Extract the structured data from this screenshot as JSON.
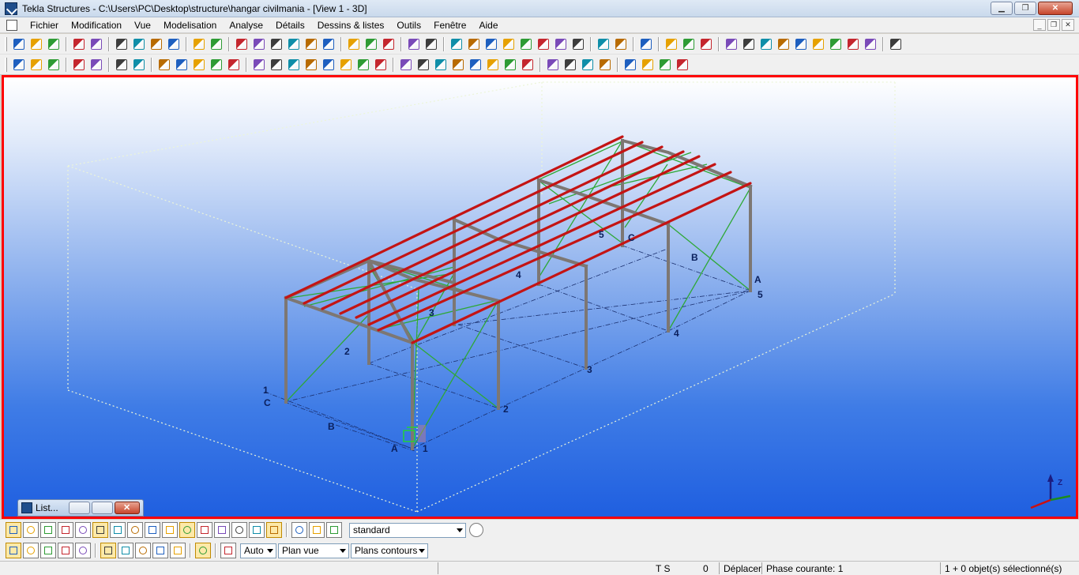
{
  "window": {
    "title": "Tekla Structures - C:\\Users\\PC\\Desktop\\structure\\hangar civilmania - [View 1 - 3D]"
  },
  "menu": [
    "Fichier",
    "Modification",
    "Vue",
    "Modelisation",
    "Analyse",
    "Détails",
    "Dessins & listes",
    "Outils",
    "Fenêtre",
    "Aide"
  ],
  "toolbar1_icons": [
    "new-icon",
    "open-icon",
    "save-icon",
    "undo-icon",
    "redo-icon",
    "copy-icon",
    "open-folder-icon",
    "print-icon",
    "numbering-icon",
    "view-icon",
    "window-icon",
    "cut-icon",
    "select-icon",
    "part-icon",
    "copy-part-icon",
    "assembly-icon",
    "drawing-icon",
    "arrow-icon",
    "component-icon",
    "component2-icon",
    "help-icon",
    "part-info-icon",
    "grid-icon",
    "axis-icon",
    "line-icon",
    "measure-icon",
    "bolt-icon",
    "weld-icon",
    "duplicate-icon",
    "copy-green-icon",
    "catalog-icon",
    "report-icon",
    "globe-icon",
    "more-icon",
    "wizard-icon",
    "apply-icon",
    "beam-icon",
    "column-icon",
    "curved-beam-icon",
    "polybeam-icon",
    "plate-icon",
    "slab-icon",
    "panel-icon",
    "rebar-icon",
    "pad-icon",
    "arrow2-icon"
  ],
  "toolbar2_icons": [
    "zoom-in-icon",
    "zoom-out-icon",
    "zoom-original-icon",
    "pick-icon",
    "clip-icon",
    "view-list-icon",
    "view-props-icon",
    "select-all-icon",
    "select-parts-icon",
    "select-surface-icon",
    "select-assembly-icon",
    "select-component-icon",
    "snap-line-icon",
    "snap-point-icon",
    "snap-check-icon",
    "snap-cross-icon",
    "snap-x-icon",
    "snap-end-icon",
    "snap-perp-icon",
    "snap-center-icon",
    "query-icon",
    "query2-icon",
    "clash-icon",
    "clash2-icon",
    "inquire-icon",
    "inquire2-icon",
    "inquire3-icon",
    "inquire4-icon",
    "binoculars-icon",
    "filter-icon",
    "tree-icon",
    "cube-icon",
    "red-bar-icon",
    "red-slash-icon",
    "red-square-icon",
    "eraser-icon"
  ],
  "viewport": {
    "grid_labels": [
      "1",
      "C",
      "B",
      "A",
      "1",
      "2",
      "2",
      "3",
      "3",
      "4",
      "4",
      "5",
      "5",
      "A",
      "B",
      "C"
    ]
  },
  "list_window": {
    "title": "List..."
  },
  "snapbar1_icons": [
    "select-all-sb-icon",
    "select-parts-sb-icon",
    "select-surfaces-sb-icon",
    "select-points-sb-icon",
    "select-grid-sb-icon",
    "select-gridline-sb-icon",
    "select-welds-sb-icon",
    "select-cuts-sb-icon",
    "select-views-sb-icon",
    "select-bolts-sb-icon",
    "select-rebar-sb-icon",
    "select-connection-sb-icon",
    "select-details-sb-icon",
    "select-assemblies-sb-icon",
    "select-objects-sb-icon",
    "select-filter-sb-icon",
    "select-component-sb-icon",
    "select-outline-sb-icon",
    "select-dotted-sb-icon"
  ],
  "filter_select": "standard",
  "snapbar2_icons": [
    "snap-ref-lines-icon",
    "snap-geometry-icon",
    "snap-center-sb-icon",
    "snap-midpoint-icon",
    "snap-intersection-icon",
    "snap-perpendicular-icon",
    "snap-extension-icon",
    "snap-any-icon",
    "snap-nearest-icon",
    "snap-line-sb-icon",
    "snap-plane-icon",
    "snap-3d-icon"
  ],
  "plane_mode": "Auto",
  "view_plane": "Plan vue",
  "contours": "Plans contours",
  "status": {
    "ts": "T S",
    "count": "0",
    "mode": "Déplacer",
    "phase": "Phase courante: 1",
    "selection": "1 + 0 objet(s) sélectionné(s)"
  }
}
